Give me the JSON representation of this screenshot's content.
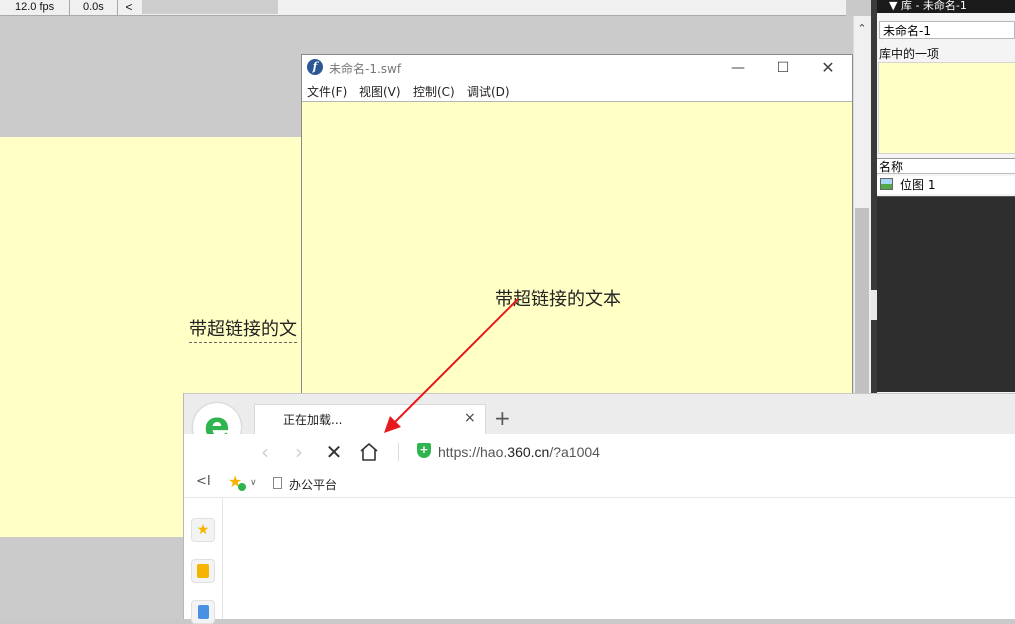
{
  "timeline": {
    "fps": "12.0 fps",
    "time": "0.0s",
    "scroll_left": "<"
  },
  "stage": {
    "text": "带超链接的文"
  },
  "library": {
    "header": "▼ 库 - 未命名-1",
    "document": "未命名-1",
    "selected_item_label": "库中的一项",
    "column_name": "名称",
    "items": [
      {
        "name": "位图 1",
        "icon": "bitmap-icon"
      }
    ]
  },
  "swf_window": {
    "title": "未命名-1.swf",
    "logo": "f",
    "controls": {
      "minimize": "—",
      "maximize": "☐",
      "close": "✕"
    },
    "menu": [
      {
        "label": "文件(F)"
      },
      {
        "label": "视图(V)"
      },
      {
        "label": "控制(C)"
      },
      {
        "label": "调试(D)"
      }
    ],
    "link_text": "带超链接的文本"
  },
  "browser": {
    "logo": "e",
    "tab": {
      "title": "正在加载...",
      "close": "×"
    },
    "new_tab": "+",
    "nav": {
      "back": "‹",
      "forward": "›",
      "stop": "✕"
    },
    "address": {
      "scheme": "https://hao.",
      "domain": "360.cn",
      "path": "/?a1004"
    },
    "bookmarks": {
      "collapse": "<I",
      "dropdown": "∨",
      "items": [
        {
          "label": "办公平台"
        }
      ]
    },
    "sidebar": {
      "fav": "★"
    }
  },
  "colors": {
    "stage_bg": "#ffffc6",
    "arrow": "#e8191c",
    "brand_green": "#2fb44f"
  }
}
